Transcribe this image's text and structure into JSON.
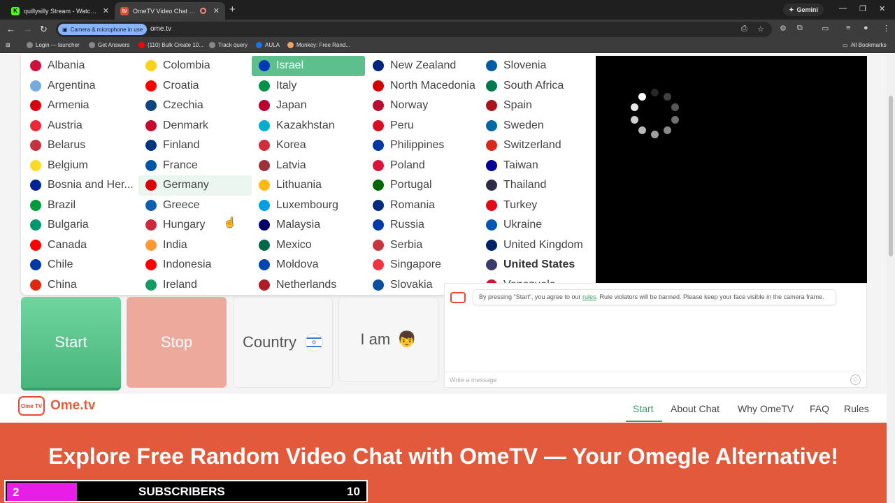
{
  "browser": {
    "tabs": [
      {
        "title": "quillysilly Stream - Watch Live o",
        "favicon": "K"
      },
      {
        "title": "OmeTV Video Chat — Ome",
        "favicon": "tv"
      }
    ],
    "new_tab": "+",
    "gemini_label": "Gemini",
    "permission_chip": "Camera & microphone in use",
    "url": "ome.tv",
    "bookmarks": [
      {
        "label": "Login — launcher",
        "color": "#888888"
      },
      {
        "label": "Get Answers",
        "color": "#888888"
      },
      {
        "label": "(110) Bulk Create 10...",
        "color": "#ff0000"
      },
      {
        "label": "Track query",
        "color": "#888888"
      },
      {
        "label": "AULA",
        "color": "#1a73e8"
      },
      {
        "label": "Monkey: Free Rand...",
        "color": "#f4a261"
      }
    ],
    "all_bookmarks": "All Bookmarks"
  },
  "dropdown": {
    "columns": [
      [
        {
          "name": "Albania",
          "flag": "#d0103a"
        },
        {
          "name": "Argentina",
          "flag": "#74acdf"
        },
        {
          "name": "Armenia",
          "flag": "#d90012"
        },
        {
          "name": "Austria",
          "flag": "#ed2939"
        },
        {
          "name": "Belarus",
          "flag": "#c8313e"
        },
        {
          "name": "Belgium",
          "flag": "#fdda24"
        },
        {
          "name": "Bosnia and Her...",
          "flag": "#002395"
        },
        {
          "name": "Brazil",
          "flag": "#009c3b"
        },
        {
          "name": "Bulgaria",
          "flag": "#00966e"
        },
        {
          "name": "Canada",
          "flag": "#ff0000"
        },
        {
          "name": "Chile",
          "flag": "#0039a6"
        },
        {
          "name": "China",
          "flag": "#de2910"
        }
      ],
      [
        {
          "name": "Colombia",
          "flag": "#fcd116"
        },
        {
          "name": "Croatia",
          "flag": "#ff0000"
        },
        {
          "name": "Czechia",
          "flag": "#11457e"
        },
        {
          "name": "Denmark",
          "flag": "#c60c30"
        },
        {
          "name": "Finland",
          "flag": "#003580"
        },
        {
          "name": "France",
          "flag": "#0055a4"
        },
        {
          "name": "Germany",
          "flag": "#dd0000",
          "state": "hover"
        },
        {
          "name": "Greece",
          "flag": "#0d5eaf"
        },
        {
          "name": "Hungary",
          "flag": "#cd2a3e"
        },
        {
          "name": "India",
          "flag": "#ff9933"
        },
        {
          "name": "Indonesia",
          "flag": "#ff0000"
        },
        {
          "name": "Ireland",
          "flag": "#169b62"
        }
      ],
      [
        {
          "name": "Israel",
          "flag": "#0038b8",
          "state": "selected"
        },
        {
          "name": "Italy",
          "flag": "#009246"
        },
        {
          "name": "Japan",
          "flag": "#bc002d"
        },
        {
          "name": "Kazakhstan",
          "flag": "#00afca"
        },
        {
          "name": "Korea",
          "flag": "#cd2e3a"
        },
        {
          "name": "Latvia",
          "flag": "#9e3039"
        },
        {
          "name": "Lithuania",
          "flag": "#fdb913"
        },
        {
          "name": "Luxembourg",
          "flag": "#00a1de"
        },
        {
          "name": "Malaysia",
          "flag": "#010066"
        },
        {
          "name": "Mexico",
          "flag": "#006847"
        },
        {
          "name": "Moldova",
          "flag": "#0046ae"
        },
        {
          "name": "Netherlands",
          "flag": "#ae1c28"
        }
      ],
      [
        {
          "name": "New Zealand",
          "flag": "#00247d"
        },
        {
          "name": "North Macedonia",
          "flag": "#d20000"
        },
        {
          "name": "Norway",
          "flag": "#ba0c2f"
        },
        {
          "name": "Peru",
          "flag": "#d91023"
        },
        {
          "name": "Philippines",
          "flag": "#0038a8"
        },
        {
          "name": "Poland",
          "flag": "#dc143c"
        },
        {
          "name": "Portugal",
          "flag": "#006600"
        },
        {
          "name": "Romania",
          "flag": "#002b7f"
        },
        {
          "name": "Russia",
          "flag": "#0039a6"
        },
        {
          "name": "Serbia",
          "flag": "#c6363c"
        },
        {
          "name": "Singapore",
          "flag": "#ef3340"
        },
        {
          "name": "Slovakia",
          "flag": "#0b4ea2"
        }
      ],
      [
        {
          "name": "Slovenia",
          "flag": "#005da4"
        },
        {
          "name": "South Africa",
          "flag": "#007a4d"
        },
        {
          "name": "Spain",
          "flag": "#aa151b"
        },
        {
          "name": "Sweden",
          "flag": "#006aa7"
        },
        {
          "name": "Switzerland",
          "flag": "#da291c"
        },
        {
          "name": "Taiwan",
          "flag": "#000095"
        },
        {
          "name": "Thailand",
          "flag": "#2d2a4a"
        },
        {
          "name": "Turkey",
          "flag": "#e30a17"
        },
        {
          "name": "Ukraine",
          "flag": "#0057b7"
        },
        {
          "name": "United Kingdom",
          "flag": "#012169"
        },
        {
          "name": "United States",
          "flag": "#3c3b6e",
          "state": "bold"
        },
        {
          "name": "Venezuela",
          "flag": "#cf142b"
        }
      ]
    ]
  },
  "controls": {
    "start": "Start",
    "stop": "Stop",
    "country": "Country",
    "country_flag": "✡",
    "iam": "I am",
    "iam_emoji": "👦"
  },
  "chat": {
    "notice_prefix": "By pressing \"Start\", you agree to our ",
    "rules_link": "rules",
    "notice_suffix": ". Rule violators will be banned. Please keep your face visible in the camera frame.",
    "placeholder": "Write a message"
  },
  "site_nav": {
    "logo_badge": "Ome TV",
    "logo_text": "Ome.tv",
    "links": [
      "Start",
      "About Chat",
      "Why OmeTV",
      "FAQ",
      "Rules"
    ]
  },
  "hero": {
    "headline": "Explore Free Random Video Chat with OmeTV — Your Omegle Alternative!"
  },
  "stream_overlay": {
    "count": "2",
    "label": "SUBSCRIBERS",
    "goal": "10"
  },
  "colors": {
    "accent_green": "#5cbf8c",
    "brand_red": "#e25a3b",
    "overlay_magenta": "#e91ee6"
  }
}
